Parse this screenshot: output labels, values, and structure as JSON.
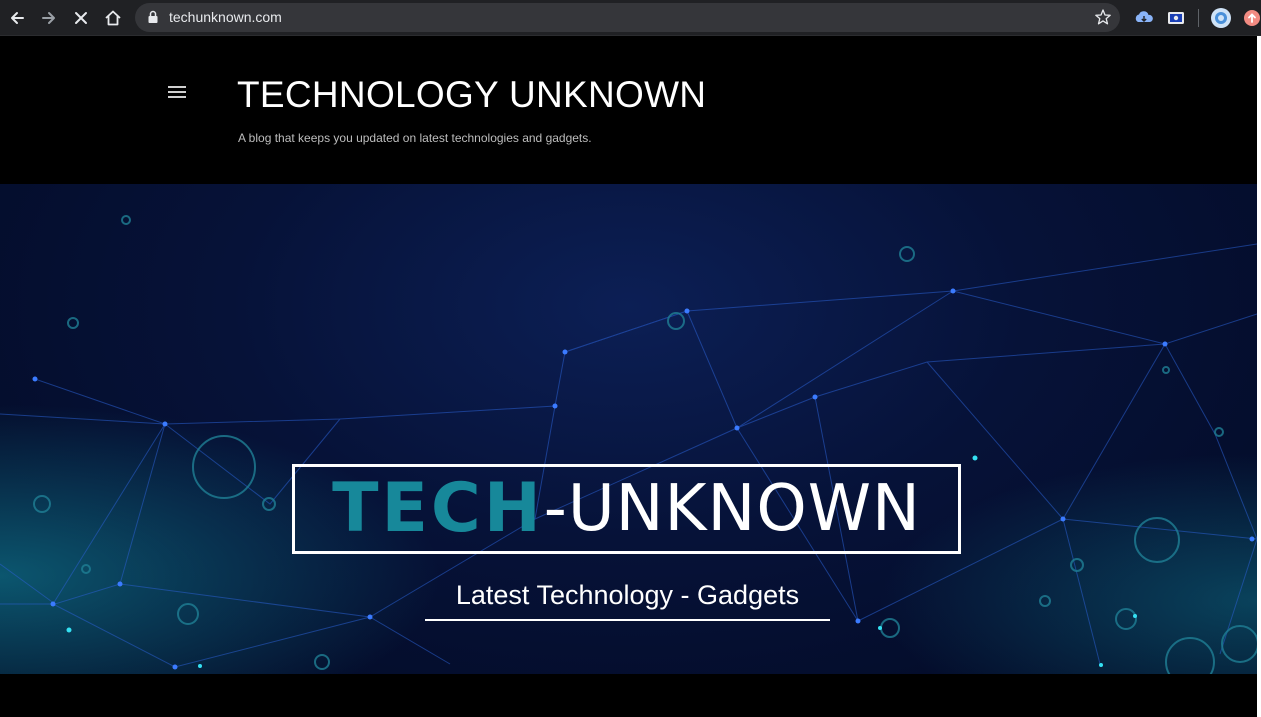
{
  "browser": {
    "url": "techunknown.com",
    "back_icon": "arrow-left-icon",
    "forward_icon": "arrow-right-icon",
    "stop_icon": "close-icon",
    "home_icon": "home-icon",
    "lock_icon": "lock-icon",
    "bookmark_icon": "star-icon",
    "extensions": [
      "cloud-icon",
      "screen-icon",
      "profile-avatar-icon",
      "update-icon"
    ]
  },
  "blog": {
    "menu_icon": "hamburger-menu-icon",
    "title": "TECHNOLOGY UNKNOWN",
    "description": "A blog that keeps you updated on latest technologies and gadgets."
  },
  "banner": {
    "logo_primary": "TECH",
    "logo_secondary": "-UNKNOWN",
    "tagline": "Latest Technology - Gadgets",
    "colors": {
      "accent": "#17889a",
      "background": "#061238",
      "network_lines": "#2a5fd0"
    }
  }
}
